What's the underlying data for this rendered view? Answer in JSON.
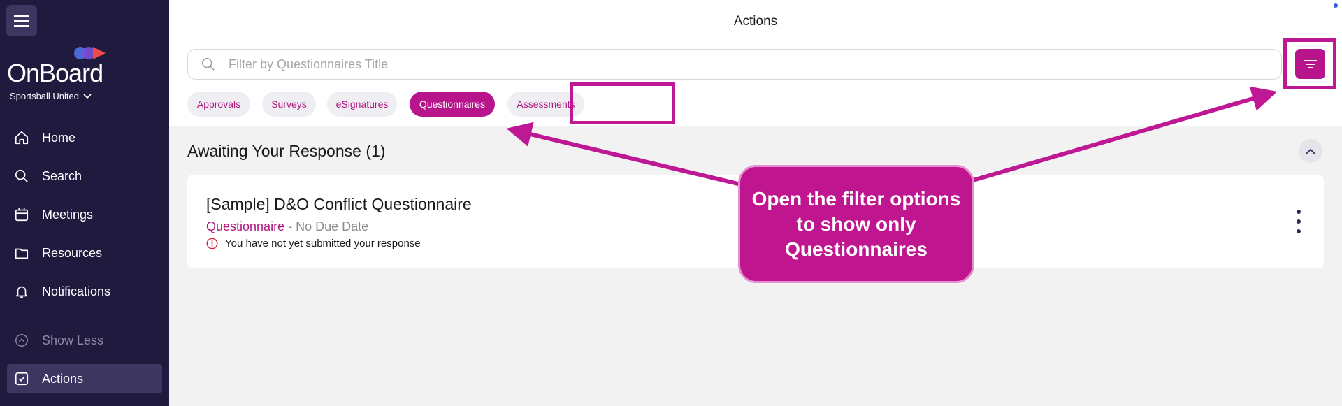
{
  "sidebar": {
    "logo_text": "OnBoard",
    "org_name": "Sportsball United",
    "items": [
      {
        "label": "Home",
        "icon": "home-icon"
      },
      {
        "label": "Search",
        "icon": "search-icon"
      },
      {
        "label": "Meetings",
        "icon": "calendar-icon"
      },
      {
        "label": "Resources",
        "icon": "folder-icon"
      },
      {
        "label": "Notifications",
        "icon": "bell-icon"
      },
      {
        "label": "Show Less",
        "icon": "chevron-up-circle-icon"
      },
      {
        "label": "Actions",
        "icon": "check-square-icon"
      }
    ]
  },
  "header": {
    "title": "Actions"
  },
  "search": {
    "placeholder": "Filter by Questionnaires Title",
    "value": ""
  },
  "tabs": [
    {
      "label": "Approvals",
      "active": false
    },
    {
      "label": "Surveys",
      "active": false
    },
    {
      "label": "eSignatures",
      "active": false
    },
    {
      "label": "Questionnaires",
      "active": true
    },
    {
      "label": "Assessments",
      "active": false
    }
  ],
  "section": {
    "title": "Awaiting Your Response (1)"
  },
  "card": {
    "title": "[Sample] D&O Conflict Questionnaire",
    "type": "Questionnaire",
    "separator": " - ",
    "due": "No Due Date",
    "warning": "You have not yet submitted your response"
  },
  "callout": {
    "text": "Open the filter options to show only Questionnaires"
  },
  "colors": {
    "sidebar_bg": "#211a3f",
    "accent": "#b8148c",
    "highlight": "#be1894",
    "warning": "#d0222f"
  }
}
